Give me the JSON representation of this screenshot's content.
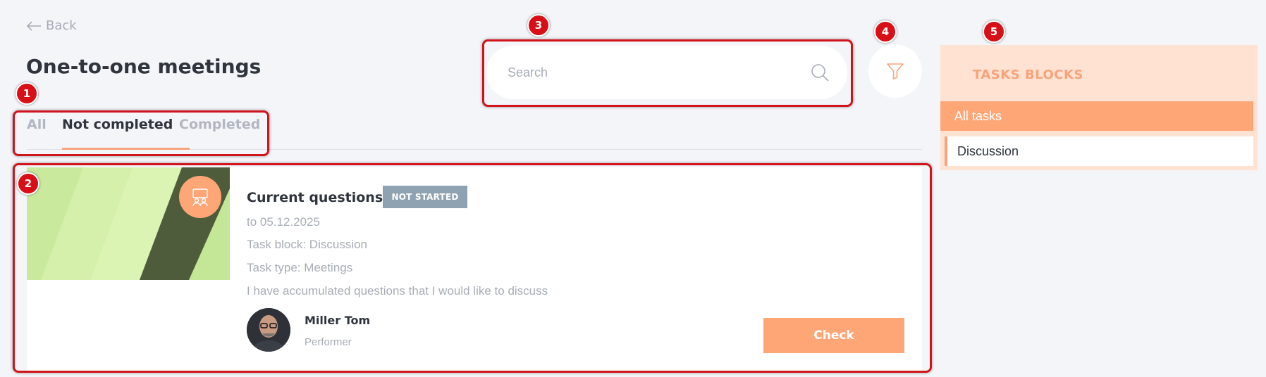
{
  "header": {
    "back_label": "Back",
    "title": "One-to-one meetings"
  },
  "tabs": [
    {
      "label": "All",
      "active": false
    },
    {
      "label": "Not completed",
      "active": true
    },
    {
      "label": "Completed",
      "active": false
    }
  ],
  "search": {
    "placeholder": "Search",
    "value": "",
    "icon": "search-icon"
  },
  "filter": {
    "icon": "filter-icon"
  },
  "sidebar": {
    "title": "TASKS BLOCKS",
    "items": [
      {
        "label": "All tasks",
        "active": true
      },
      {
        "label": "Discussion",
        "active": false
      }
    ]
  },
  "task": {
    "title": "Current questions",
    "status": "NOT STARTED",
    "due": "to 05.12.2025",
    "block": "Task block: Discussion",
    "type": "Task type: Meetings",
    "description": "I have accumulated questions that I would like to discuss",
    "type_icon": "meeting-icon",
    "person": {
      "name": "Miller Tom",
      "role": "Performer"
    },
    "action_label": "Check"
  },
  "annotations": [
    "1",
    "2",
    "3",
    "4",
    "5"
  ],
  "colors": {
    "accent": "#ffa677",
    "accent_light": "#ffe2d2",
    "badge": "#8ea2b2",
    "annotation": "#d80f16",
    "background": "#f4f5f9"
  }
}
